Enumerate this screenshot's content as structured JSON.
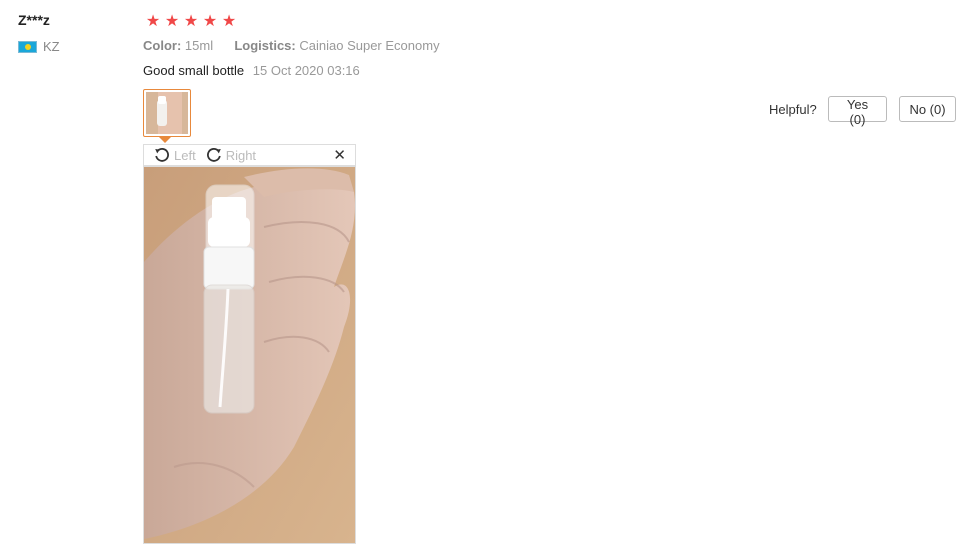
{
  "reviewer": {
    "name": "Z***z",
    "country_code": "KZ",
    "flag_icon": "kazakhstan-flag-icon"
  },
  "rating": {
    "value": 5,
    "max": 5,
    "color": "#f04848"
  },
  "attributes": {
    "color_label": "Color:",
    "color_value": "15ml",
    "logistics_label": "Logistics:",
    "logistics_value": "Cainiao Super Economy"
  },
  "review": {
    "text": "Good small bottle",
    "date": "15 Oct 2020 03:16"
  },
  "viewer": {
    "left_label": "Left",
    "right_label": "Right",
    "close_icon": "close-icon",
    "accent": "#e8893c"
  },
  "helpful": {
    "label": "Helpful?",
    "yes_label": "Yes (0)",
    "no_label": "No (0)"
  }
}
